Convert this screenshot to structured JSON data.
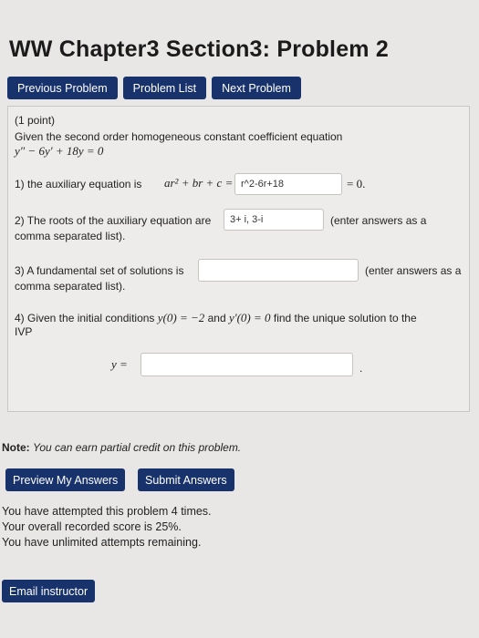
{
  "header": {
    "title": "WW Chapter3 Section3: Problem 2"
  },
  "nav": {
    "previous": "Previous Problem",
    "list": "Problem List",
    "next": "Next Problem"
  },
  "problem": {
    "points": "(1 point)",
    "statement": "Given the second order homogeneous constant coefficient equation",
    "equation": "y″ − 6y′ + 18y = 0",
    "q1": {
      "label": "1) the auxiliary equation is",
      "expr": "ar² + br + c =",
      "answer": "r^2-6r+18",
      "suffix": "= 0."
    },
    "q2": {
      "label": "2) The roots of the auxiliary equation are",
      "answer": "3+ i, 3-i",
      "hint": "(enter answers as a",
      "hint2": "comma separated list)."
    },
    "q3": {
      "label": "3) A fundamental set of solutions is",
      "answer": "",
      "hint": "(enter answers as a",
      "hint2": "comma separated list)."
    },
    "q4": {
      "label_a": "4) Given the initial conditions",
      "cond1": "y(0) = −2",
      "and": "and",
      "cond2": "y′(0) = 0",
      "label_b": "find the unique solution to the",
      "label_c": "IVP",
      "y_label": "y =",
      "answer": "",
      "suffix": "."
    }
  },
  "note": {
    "bold": "Note:",
    "text": "You can earn partial credit on this problem."
  },
  "actions": {
    "preview": "Preview My Answers",
    "submit": "Submit Answers"
  },
  "status": {
    "attempted": "You have attempted this problem 4 times.",
    "score": "Your overall recorded score is 25%.",
    "remaining": "You have unlimited attempts remaining."
  },
  "email": "Email instructor",
  "colors": {
    "button_bg": "#18326b",
    "page_bg": "#e9e7e6"
  }
}
